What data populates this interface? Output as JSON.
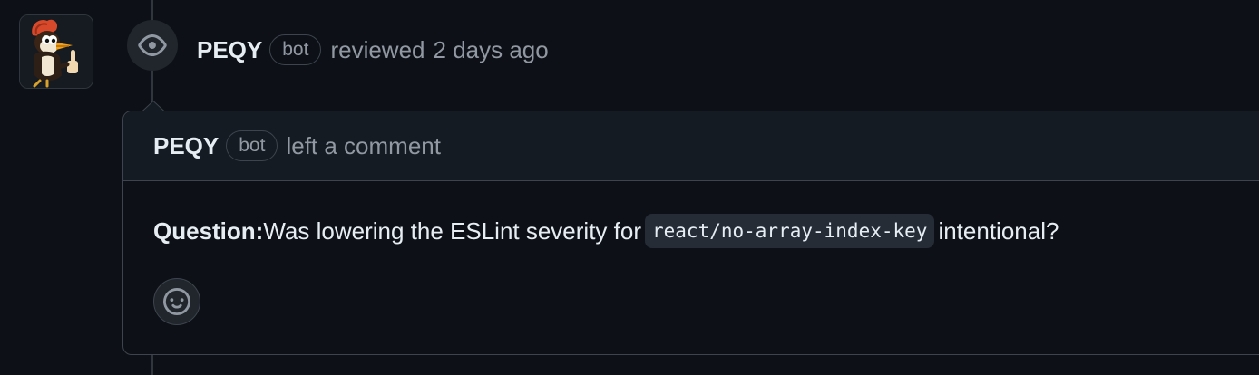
{
  "review": {
    "author": "PEQY",
    "badge": "bot",
    "action": "reviewed",
    "time_ago": "2 days ago"
  },
  "comment": {
    "author": "PEQY",
    "badge": "bot",
    "action": "left a comment",
    "label": "Question:",
    "text_before": "Was lowering the ESLint severity for",
    "code": "react/no-array-index-key",
    "text_after": "intentional?"
  },
  "icons": {
    "review": "eye-icon",
    "reaction": "smiley-icon",
    "avatar": "woodpecker-thumbs-up-avatar"
  },
  "colors": {
    "background": "#0d1117",
    "header_background": "#151b23",
    "border": "#3d444d",
    "muted_text": "#9198a1",
    "text": "#e6edf3"
  }
}
